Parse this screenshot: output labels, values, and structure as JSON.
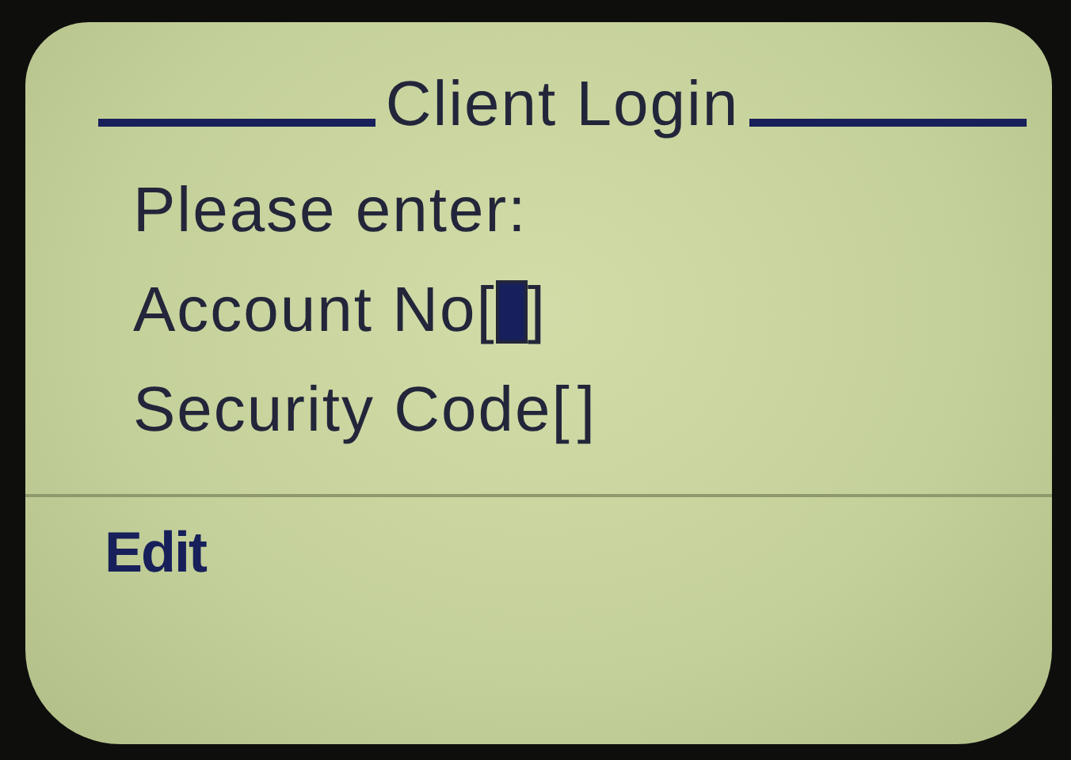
{
  "screen": {
    "title": "Client Login",
    "prompt": "Please enter:",
    "fields": [
      {
        "label": "Account No",
        "open_bracket": "[",
        "close_bracket": "]",
        "focused": true
      },
      {
        "label": "Security Code",
        "open_bracket": "[",
        "close_bracket": "]",
        "focused": false
      }
    ],
    "softkey": "Edit"
  }
}
